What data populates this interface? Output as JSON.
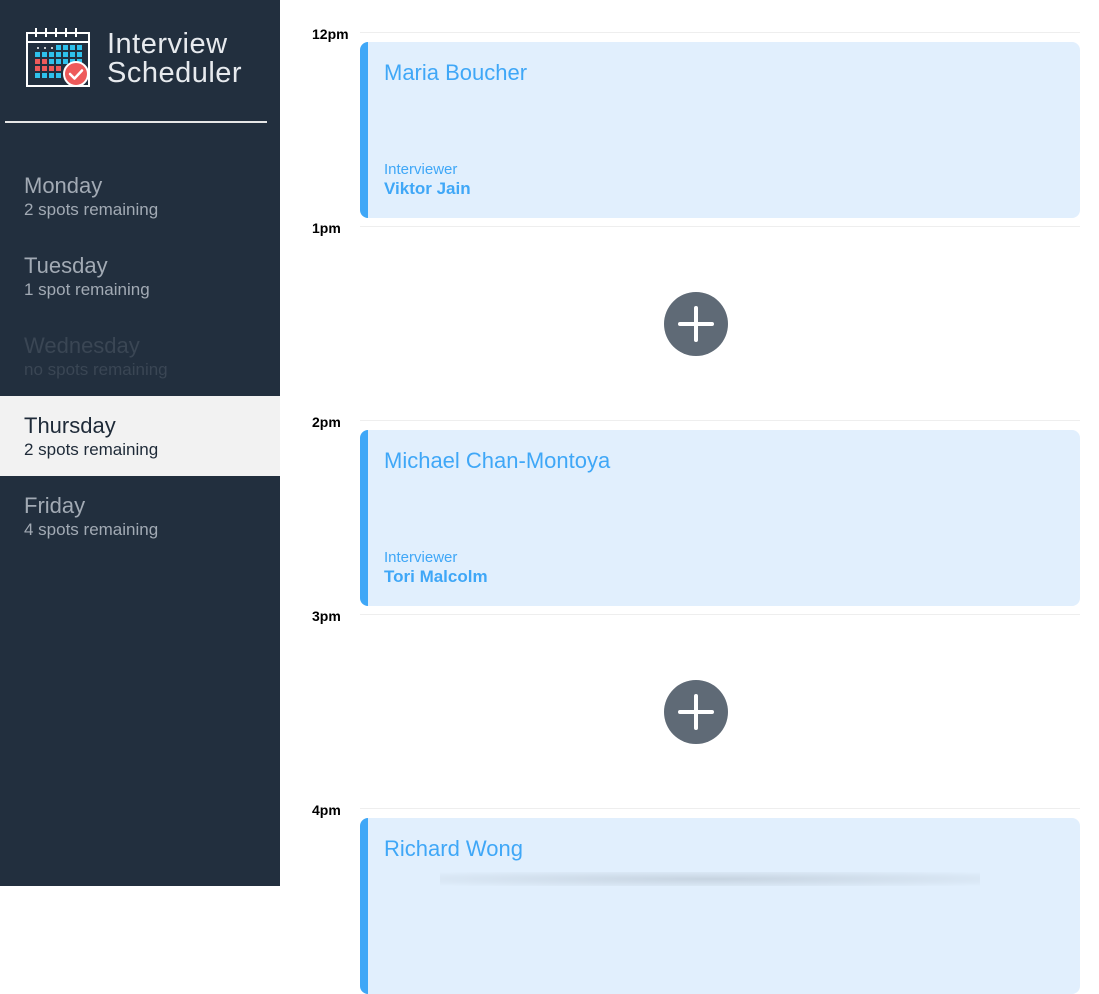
{
  "app": {
    "title_line1": "Interview",
    "title_line2": "Scheduler",
    "logo_icon": "calendar-check-icon"
  },
  "sidebar": {
    "days": [
      {
        "name": "Monday",
        "spots": "2 spots remaining"
      },
      {
        "name": "Tuesday",
        "spots": "1 spot remaining"
      },
      {
        "name": "Wednesday",
        "spots": "no spots remaining"
      },
      {
        "name": "Thursday",
        "spots": "2 spots remaining",
        "selected": true
      },
      {
        "name": "Friday",
        "spots": "4 spots remaining"
      }
    ]
  },
  "schedule": {
    "times": [
      "12pm",
      "1pm",
      "2pm",
      "3pm",
      "4pm"
    ],
    "appointments": [
      {
        "student": "Maria Boucher",
        "interviewer_label": "Interviewer",
        "interviewer": "Viktor Jain"
      },
      {
        "student": "Michael Chan-Montoya",
        "interviewer_label": "Interviewer",
        "interviewer": "Tori Malcolm"
      },
      {
        "student": "Richard Wong"
      }
    ],
    "add_icon": "plus-icon"
  },
  "colors": {
    "sidebar_bg": "#222f3e",
    "accent": "#3fa7f7",
    "appointment_bg": "#e1effd",
    "add_button": "#5f6a76"
  }
}
